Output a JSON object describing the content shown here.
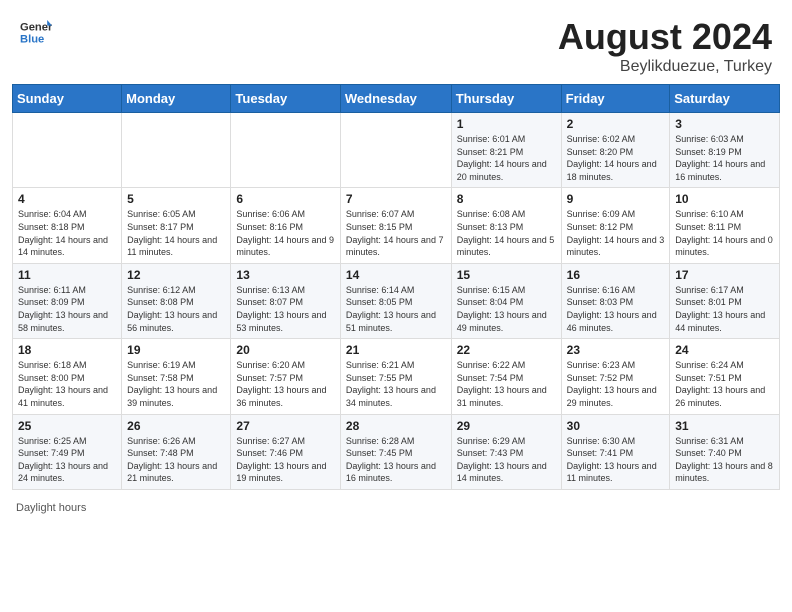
{
  "header": {
    "logo_line1": "General",
    "logo_line2": "Blue",
    "title": "August 2024",
    "subtitle": "Beylikduezue, Turkey"
  },
  "days_of_week": [
    "Sunday",
    "Monday",
    "Tuesday",
    "Wednesday",
    "Thursday",
    "Friday",
    "Saturday"
  ],
  "weeks": [
    [
      {
        "day": "",
        "info": ""
      },
      {
        "day": "",
        "info": ""
      },
      {
        "day": "",
        "info": ""
      },
      {
        "day": "",
        "info": ""
      },
      {
        "day": "1",
        "info": "Sunrise: 6:01 AM\nSunset: 8:21 PM\nDaylight: 14 hours and 20 minutes."
      },
      {
        "day": "2",
        "info": "Sunrise: 6:02 AM\nSunset: 8:20 PM\nDaylight: 14 hours and 18 minutes."
      },
      {
        "day": "3",
        "info": "Sunrise: 6:03 AM\nSunset: 8:19 PM\nDaylight: 14 hours and 16 minutes."
      }
    ],
    [
      {
        "day": "4",
        "info": "Sunrise: 6:04 AM\nSunset: 8:18 PM\nDaylight: 14 hours and 14 minutes."
      },
      {
        "day": "5",
        "info": "Sunrise: 6:05 AM\nSunset: 8:17 PM\nDaylight: 14 hours and 11 minutes."
      },
      {
        "day": "6",
        "info": "Sunrise: 6:06 AM\nSunset: 8:16 PM\nDaylight: 14 hours and 9 minutes."
      },
      {
        "day": "7",
        "info": "Sunrise: 6:07 AM\nSunset: 8:15 PM\nDaylight: 14 hours and 7 minutes."
      },
      {
        "day": "8",
        "info": "Sunrise: 6:08 AM\nSunset: 8:13 PM\nDaylight: 14 hours and 5 minutes."
      },
      {
        "day": "9",
        "info": "Sunrise: 6:09 AM\nSunset: 8:12 PM\nDaylight: 14 hours and 3 minutes."
      },
      {
        "day": "10",
        "info": "Sunrise: 6:10 AM\nSunset: 8:11 PM\nDaylight: 14 hours and 0 minutes."
      }
    ],
    [
      {
        "day": "11",
        "info": "Sunrise: 6:11 AM\nSunset: 8:09 PM\nDaylight: 13 hours and 58 minutes."
      },
      {
        "day": "12",
        "info": "Sunrise: 6:12 AM\nSunset: 8:08 PM\nDaylight: 13 hours and 56 minutes."
      },
      {
        "day": "13",
        "info": "Sunrise: 6:13 AM\nSunset: 8:07 PM\nDaylight: 13 hours and 53 minutes."
      },
      {
        "day": "14",
        "info": "Sunrise: 6:14 AM\nSunset: 8:05 PM\nDaylight: 13 hours and 51 minutes."
      },
      {
        "day": "15",
        "info": "Sunrise: 6:15 AM\nSunset: 8:04 PM\nDaylight: 13 hours and 49 minutes."
      },
      {
        "day": "16",
        "info": "Sunrise: 6:16 AM\nSunset: 8:03 PM\nDaylight: 13 hours and 46 minutes."
      },
      {
        "day": "17",
        "info": "Sunrise: 6:17 AM\nSunset: 8:01 PM\nDaylight: 13 hours and 44 minutes."
      }
    ],
    [
      {
        "day": "18",
        "info": "Sunrise: 6:18 AM\nSunset: 8:00 PM\nDaylight: 13 hours and 41 minutes."
      },
      {
        "day": "19",
        "info": "Sunrise: 6:19 AM\nSunset: 7:58 PM\nDaylight: 13 hours and 39 minutes."
      },
      {
        "day": "20",
        "info": "Sunrise: 6:20 AM\nSunset: 7:57 PM\nDaylight: 13 hours and 36 minutes."
      },
      {
        "day": "21",
        "info": "Sunrise: 6:21 AM\nSunset: 7:55 PM\nDaylight: 13 hours and 34 minutes."
      },
      {
        "day": "22",
        "info": "Sunrise: 6:22 AM\nSunset: 7:54 PM\nDaylight: 13 hours and 31 minutes."
      },
      {
        "day": "23",
        "info": "Sunrise: 6:23 AM\nSunset: 7:52 PM\nDaylight: 13 hours and 29 minutes."
      },
      {
        "day": "24",
        "info": "Sunrise: 6:24 AM\nSunset: 7:51 PM\nDaylight: 13 hours and 26 minutes."
      }
    ],
    [
      {
        "day": "25",
        "info": "Sunrise: 6:25 AM\nSunset: 7:49 PM\nDaylight: 13 hours and 24 minutes."
      },
      {
        "day": "26",
        "info": "Sunrise: 6:26 AM\nSunset: 7:48 PM\nDaylight: 13 hours and 21 minutes."
      },
      {
        "day": "27",
        "info": "Sunrise: 6:27 AM\nSunset: 7:46 PM\nDaylight: 13 hours and 19 minutes."
      },
      {
        "day": "28",
        "info": "Sunrise: 6:28 AM\nSunset: 7:45 PM\nDaylight: 13 hours and 16 minutes."
      },
      {
        "day": "29",
        "info": "Sunrise: 6:29 AM\nSunset: 7:43 PM\nDaylight: 13 hours and 14 minutes."
      },
      {
        "day": "30",
        "info": "Sunrise: 6:30 AM\nSunset: 7:41 PM\nDaylight: 13 hours and 11 minutes."
      },
      {
        "day": "31",
        "info": "Sunrise: 6:31 AM\nSunset: 7:40 PM\nDaylight: 13 hours and 8 minutes."
      }
    ]
  ],
  "footer": {
    "note": "Daylight hours"
  }
}
